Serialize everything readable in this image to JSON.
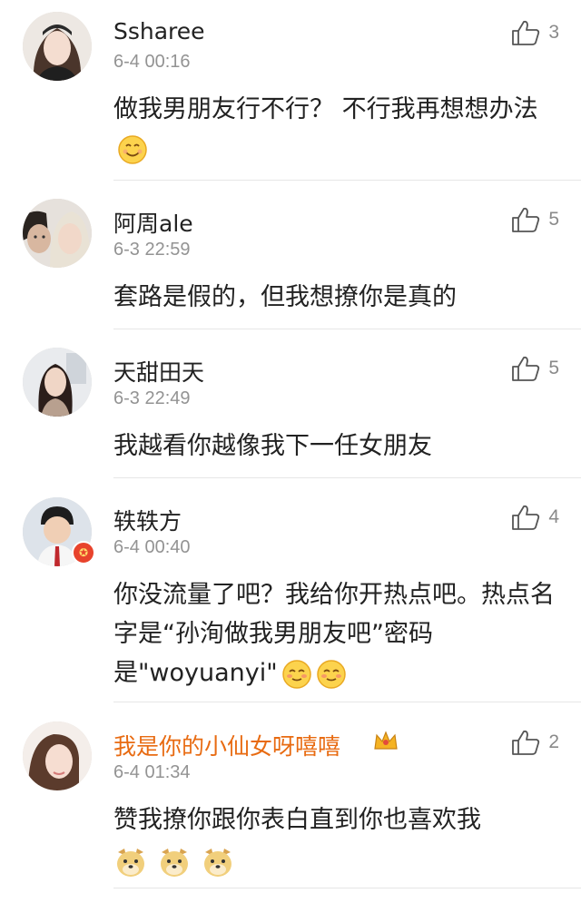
{
  "comments": [
    {
      "username": "Ssharee",
      "time": "6-4 00:16",
      "likes": "3",
      "text": "做我男朋友行不行？ 不行我再想想办法",
      "emojis": [
        "smile"
      ]
    },
    {
      "username": "阿周ale",
      "time": "6-3 22:59",
      "likes": "5",
      "text": "套路是假的，但我想撩你是真的"
    },
    {
      "username": "天甜田天",
      "time": "6-3 22:49",
      "likes": "5",
      "text": "我越看你越像我下一任女朋友"
    },
    {
      "username": "轶轶方",
      "time": "6-4 00:40",
      "likes": "4",
      "text": "你没流量了吧？我给你开热点吧。热点名字是“孙洵做我男朋友吧”密码是\"woyuanyi\"",
      "emojis": [
        "blush",
        "blush"
      ],
      "vip_badge": true
    },
    {
      "username": "我是你的小仙女呀嘻嘻",
      "time": "6-4 01:34",
      "likes": "2",
      "text": "赞我撩你跟你表白直到你也喜欢我",
      "emojis": [
        "doge",
        "doge",
        "doge"
      ],
      "crown_badge": true
    }
  ],
  "colors": {
    "vip_name": "#e86b12",
    "text": "#222222",
    "meta": "#939393"
  }
}
